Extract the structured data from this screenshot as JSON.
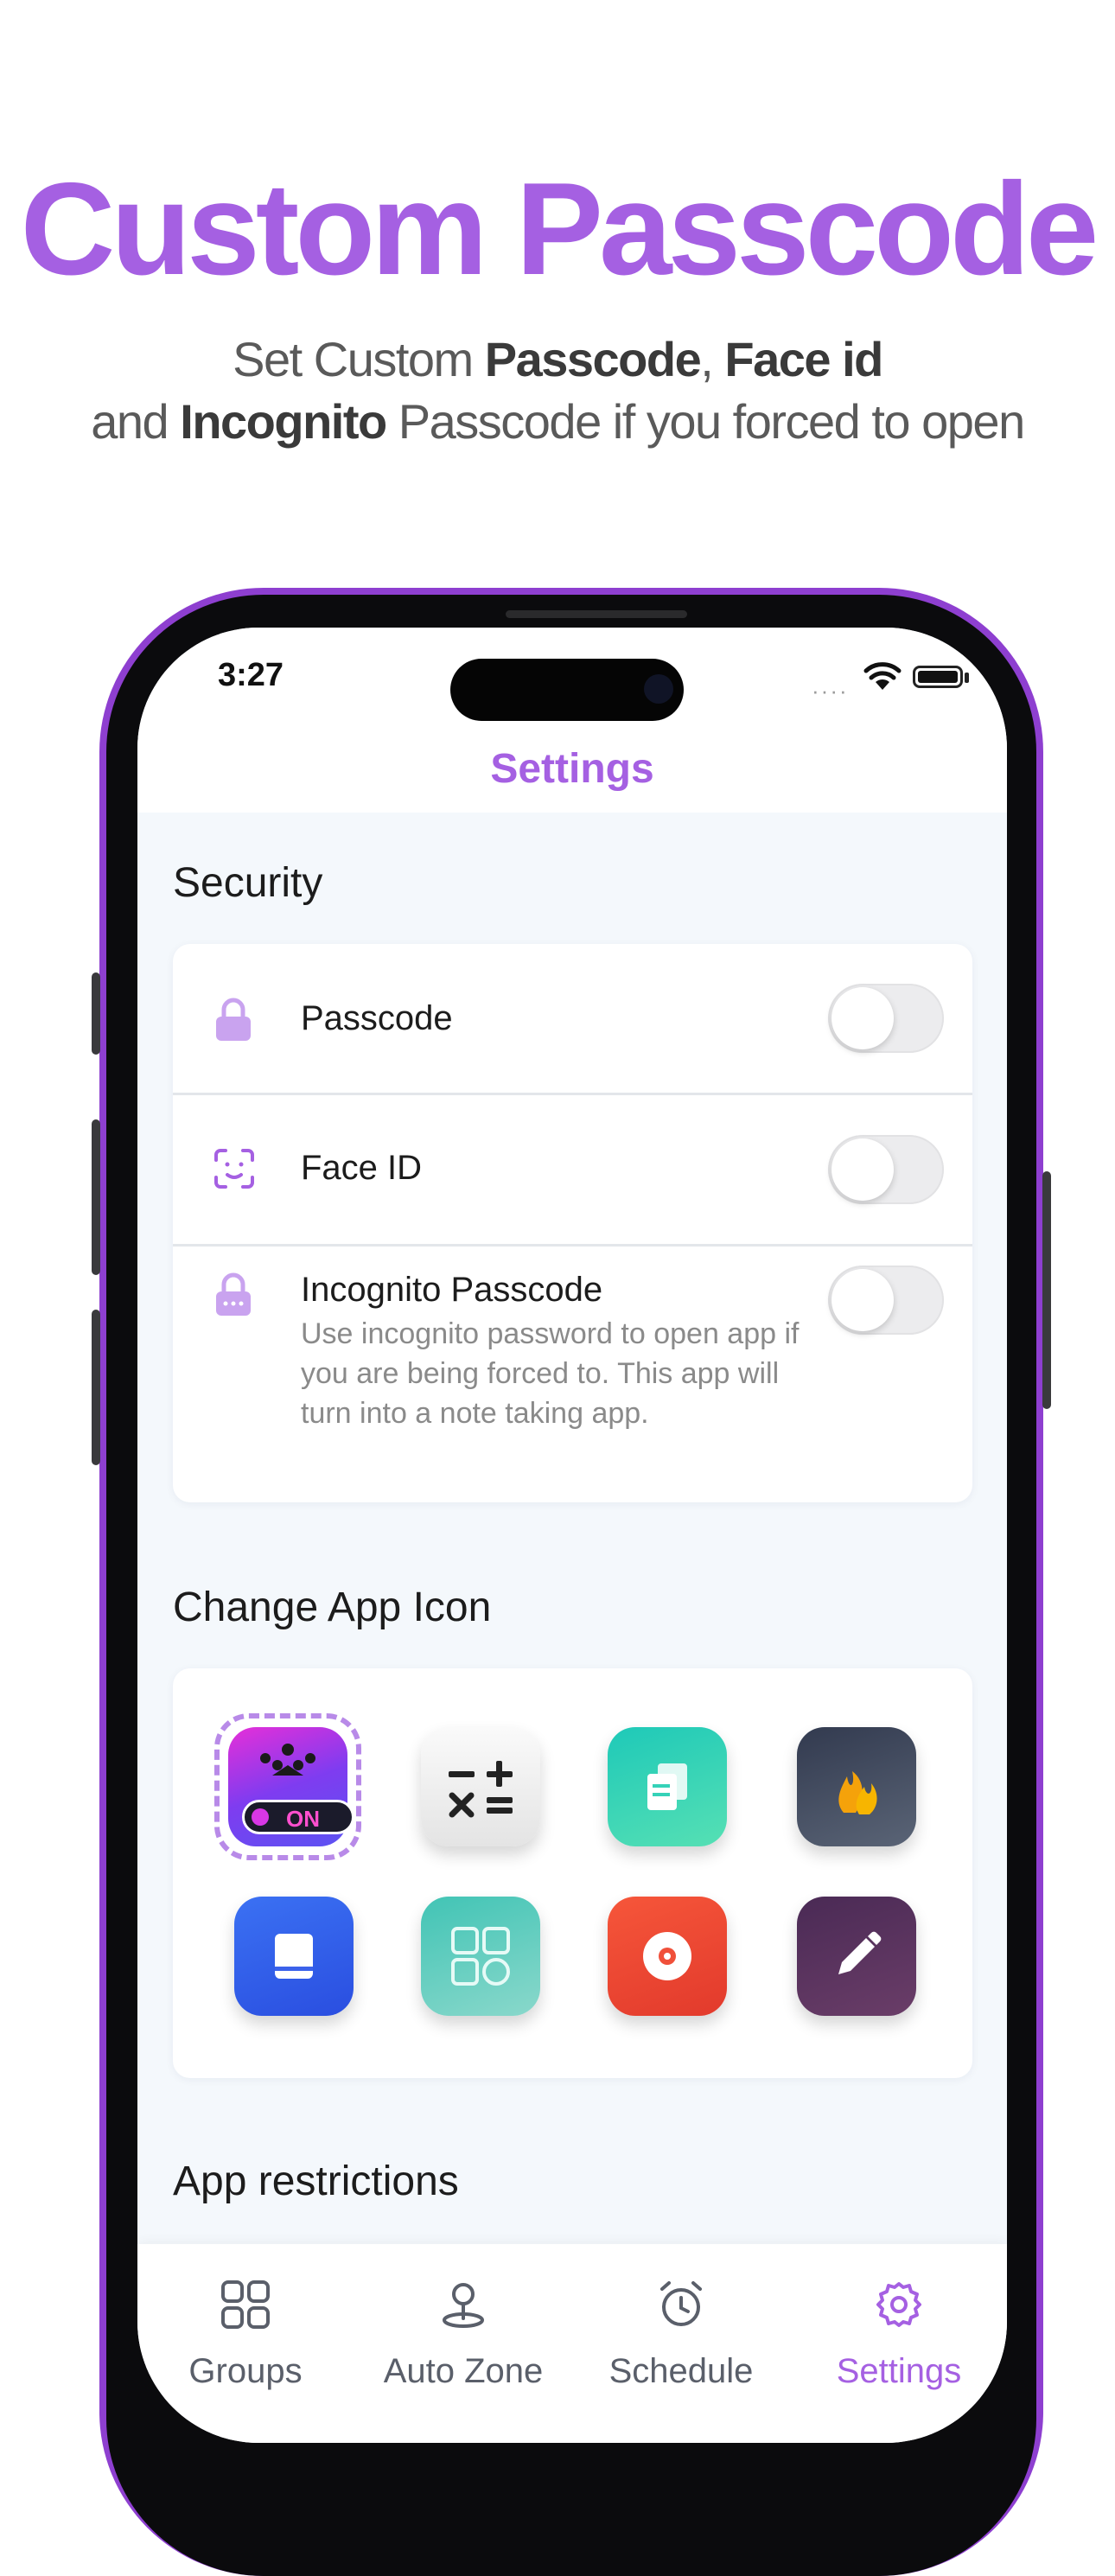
{
  "headline": "Custom Passcode",
  "subtitle": {
    "line1_prefix": "Set Custom ",
    "line1_bold1": "Passcode",
    "line1_sep": ", ",
    "line1_bold2": "Face id",
    "line2_prefix": "and ",
    "line2_bold": "Incognito",
    "line2_suffix": " Passcode if you forced to open"
  },
  "status_bar": {
    "time": "3:27",
    "signal": "····"
  },
  "nav": {
    "title": "Settings"
  },
  "security": {
    "title": "Security",
    "rows": [
      {
        "label": "Passcode",
        "icon": "lock-icon",
        "toggle_on": false
      },
      {
        "label": "Face ID",
        "icon": "face-id-icon",
        "toggle_on": false
      },
      {
        "label": "Incognito Passcode",
        "icon": "incognito-lock-icon",
        "toggle_on": false,
        "description": "Use incognito password to open app if you are being forced to. This app will turn into a note taking app."
      }
    ]
  },
  "app_icon": {
    "title": "Change App Icon",
    "selected_badge": "ON",
    "icons": [
      {
        "name": "default-app-icon",
        "selected": true
      },
      {
        "name": "calculator-icon"
      },
      {
        "name": "documents-icon"
      },
      {
        "name": "flame-icon"
      },
      {
        "name": "book-icon"
      },
      {
        "name": "widgets-icon"
      },
      {
        "name": "music-disc-icon"
      },
      {
        "name": "notes-pencil-icon"
      }
    ]
  },
  "restrictions": {
    "title": "App restrictions"
  },
  "tabs": [
    {
      "label": "Groups",
      "icon": "groups-grid-icon",
      "active": false
    },
    {
      "label": "Auto Zone",
      "icon": "location-pin-icon",
      "active": false
    },
    {
      "label": "Schedule",
      "icon": "alarm-clock-icon",
      "active": false
    },
    {
      "label": "Settings",
      "icon": "gear-icon",
      "active": true
    }
  ],
  "colors": {
    "accent": "#a560e2",
    "phone_frame": "#8e3fd0",
    "background": "#f4f8fc"
  }
}
